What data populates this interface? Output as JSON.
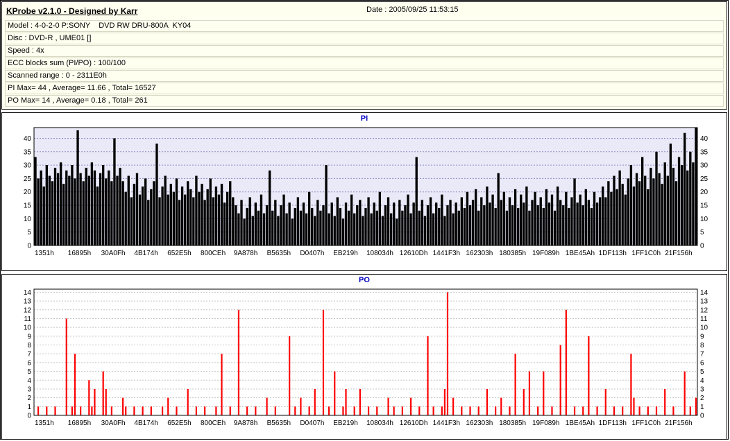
{
  "header": {
    "app_title": "KProbe v2.1.0 - Designed by Karr",
    "date": "Date : 2005/09/25 11:53:15",
    "rows": [
      "Model : 4-0-2-0 P:SONY    DVD RW DRU-800A  KY04",
      "Disc : DVD-R , UME01 []",
      "Speed : 4x",
      "ECC blocks sum (PI/PO) : 100/100",
      "Scanned range : 0 - 2311E0h",
      "PI Max= 44 , Average= 11.66 , Total= 16527",
      "PO Max= 14 , Average= 0.18 , Total= 261"
    ]
  },
  "colors": {
    "header_bg": "#fffff0",
    "title_blue": "#0000c0",
    "pi_bar": "#000000",
    "po_bar": "#ff0000",
    "pi_plot_bg": "#e9e9f8"
  },
  "stats": {
    "pi_max": 44,
    "pi_average": 11.66,
    "pi_total": 16527,
    "po_max": 14,
    "po_average": 0.18,
    "po_total": 261
  },
  "chart_data": [
    {
      "id": "pi",
      "type": "bar",
      "title": "PI",
      "bar_color": "#000000",
      "plot_bg": "#e9e9f8",
      "grid_color": "#8f8fc0",
      "ylim": [
        0,
        44
      ],
      "ytick_step": 5,
      "ymax_label": 40,
      "grid": true,
      "legend": "none",
      "categories": [
        "1351h",
        "16895h",
        "30A0Fh",
        "4B174h",
        "652E5h",
        "800CEh",
        "9A878h",
        "B5635h",
        "D0407h",
        "EB219h",
        "108034h",
        "12610Dh",
        "1441F3h",
        "162303h",
        "180385h",
        "19F089h",
        "1BE45Ah",
        "1DF113h",
        "1FF1C0h",
        "21F156h"
      ],
      "values": [
        33,
        25,
        28,
        22,
        30,
        26,
        24,
        29,
        27,
        31,
        23,
        28,
        26,
        30,
        25,
        43,
        27,
        24,
        29,
        26,
        31,
        28,
        22,
        27,
        30,
        25,
        28,
        24,
        40,
        26,
        29,
        24,
        20,
        26,
        18,
        23,
        27,
        19,
        22,
        25,
        17,
        21,
        24,
        38,
        18,
        22,
        26,
        19,
        23,
        20,
        25,
        17,
        22,
        19,
        24,
        21,
        18,
        26,
        20,
        23,
        17,
        21,
        25,
        18,
        22,
        19,
        23,
        16,
        20,
        24,
        18,
        15,
        12,
        17,
        10,
        14,
        18,
        11,
        16,
        13,
        19,
        12,
        15,
        28,
        13,
        17,
        11,
        15,
        19,
        12,
        16,
        10,
        14,
        18,
        13,
        16,
        12,
        20,
        14,
        11,
        17,
        13,
        15,
        30,
        12,
        16,
        11,
        18,
        14,
        10,
        16,
        13,
        19,
        12,
        15,
        17,
        11,
        14,
        18,
        12,
        16,
        13,
        20,
        11,
        15,
        18,
        12,
        16,
        10,
        17,
        13,
        15,
        19,
        12,
        16,
        33,
        13,
        17,
        11,
        15,
        18,
        12,
        16,
        14,
        19,
        11,
        15,
        17,
        12,
        16,
        13,
        18,
        14,
        20,
        15,
        17,
        21,
        13,
        18,
        15,
        22,
        16,
        19,
        14,
        27,
        17,
        20,
        13,
        18,
        15,
        21,
        14,
        19,
        16,
        22,
        13,
        17,
        20,
        15,
        18,
        14,
        21,
        16,
        19,
        13,
        22,
        17,
        15,
        20,
        14,
        18,
        25,
        16,
        19,
        15,
        21,
        17,
        14,
        20,
        16,
        18,
        22,
        18,
        24,
        20,
        26,
        21,
        28,
        23,
        19,
        25,
        30,
        22,
        27,
        24,
        33,
        26,
        21,
        29,
        25,
        35,
        27,
        23,
        31,
        26,
        38,
        29,
        24,
        33,
        30,
        42,
        28,
        35,
        31,
        44
      ]
    },
    {
      "id": "po",
      "type": "bar",
      "title": "PO",
      "bar_color": "#ff0000",
      "plot_bg": "#ffffff",
      "grid_color": "#c4c4c4",
      "ylim": [
        0,
        14.35
      ],
      "ytick_step": 1,
      "ymax_label": 14,
      "grid": true,
      "legend": "none",
      "categories": [
        "1351h",
        "16895h",
        "30A0Fh",
        "4B174h",
        "652E5h",
        "800CEh",
        "9A878h",
        "B5635h",
        "D0407h",
        "EB219h",
        "108034h",
        "12610Dh",
        "1441F3h",
        "162303h",
        "180385h",
        "19F089h",
        "1BE45Ah",
        "1DF113h",
        "1FF1C0h",
        "21F156h"
      ],
      "values": [
        0,
        1,
        0,
        0,
        1,
        0,
        0,
        1,
        0,
        0,
        0,
        11,
        0,
        1,
        7,
        0,
        1,
        0,
        0,
        4,
        1,
        3,
        0,
        0,
        5,
        3,
        0,
        1,
        0,
        0,
        0,
        2,
        1,
        0,
        0,
        1,
        0,
        0,
        1,
        0,
        0,
        1,
        0,
        0,
        0,
        1,
        0,
        2,
        0,
        0,
        1,
        0,
        0,
        0,
        3,
        0,
        0,
        1,
        0,
        0,
        1,
        0,
        0,
        0,
        1,
        0,
        7,
        0,
        0,
        1,
        0,
        0,
        12,
        0,
        0,
        1,
        0,
        0,
        1,
        0,
        0,
        0,
        2,
        0,
        0,
        1,
        0,
        0,
        0,
        0,
        9,
        0,
        1,
        0,
        2,
        0,
        0,
        1,
        0,
        3,
        0,
        0,
        12,
        0,
        1,
        0,
        5,
        0,
        0,
        1,
        3,
        0,
        0,
        1,
        0,
        3,
        0,
        0,
        1,
        0,
        0,
        1,
        0,
        0,
        0,
        2,
        0,
        1,
        0,
        0,
        1,
        0,
        0,
        2,
        0,
        0,
        1,
        0,
        0,
        9,
        0,
        1,
        0,
        0,
        1,
        3,
        14,
        0,
        2,
        0,
        0,
        1,
        0,
        0,
        1,
        0,
        0,
        1,
        0,
        0,
        3,
        0,
        0,
        1,
        0,
        2,
        0,
        0,
        1,
        0,
        7,
        0,
        0,
        3,
        0,
        5,
        0,
        0,
        1,
        0,
        5,
        0,
        0,
        1,
        0,
        0,
        8,
        0,
        12,
        0,
        0,
        1,
        0,
        0,
        1,
        0,
        9,
        0,
        0,
        1,
        0,
        0,
        3,
        0,
        0,
        1,
        0,
        0,
        1,
        0,
        0,
        7,
        2,
        0,
        1,
        0,
        0,
        1,
        0,
        0,
        1,
        0,
        0,
        3,
        0,
        0,
        1,
        0,
        0,
        0,
        5,
        0,
        1,
        0,
        2
      ]
    }
  ]
}
